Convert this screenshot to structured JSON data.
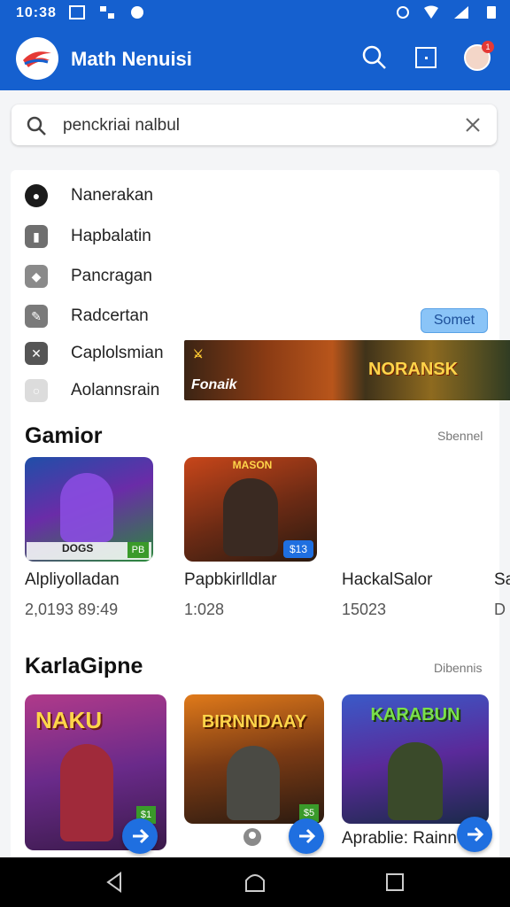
{
  "status_bar": {
    "time": "10:38"
  },
  "app": {
    "title": "Math Nenuisi"
  },
  "search": {
    "value": "penckriai nalbul"
  },
  "menu": [
    {
      "label": "Nanerakan",
      "icon": "chat-bubble-icon"
    },
    {
      "label": "Hapbalatin",
      "icon": "bookmark-icon"
    },
    {
      "label": "Pancragan",
      "icon": "tag-icon"
    },
    {
      "label": "Radcertan",
      "icon": "leaf-icon"
    },
    {
      "label": "Caplolsmian",
      "icon": "close-icon"
    },
    {
      "label": "Aolannsrain",
      "icon": "circle-icon"
    }
  ],
  "pill_label": "Somet",
  "banner": {
    "left_text": "Fonaik",
    "right_text": "NORANSK"
  },
  "sections": [
    {
      "title": "Gamior",
      "more": "Sbennel",
      "items": [
        {
          "name": "Alpliyolladan",
          "sub": "2,0193 89:49",
          "badge": "PB",
          "caption": "DOGS"
        },
        {
          "name": "Papbkirlldlar",
          "sub": "1:028",
          "badge": "$13",
          "caption": "MASON"
        },
        {
          "name": "HackalSalor",
          "sub": "15023"
        },
        {
          "name": "Sa",
          "sub": "D"
        }
      ]
    },
    {
      "title": "KarlaGipne",
      "more": "Dibennis",
      "items": [
        {
          "name": "",
          "caption": "NAKU",
          "badge": "$1"
        },
        {
          "name": "",
          "caption": "BIRNNDAAY",
          "badge": "$5"
        },
        {
          "name": "Aprablie: Rainn",
          "caption": "KARABUN"
        }
      ]
    }
  ],
  "colors": {
    "primary": "#1560cf",
    "accent": "#1f6fe0"
  }
}
